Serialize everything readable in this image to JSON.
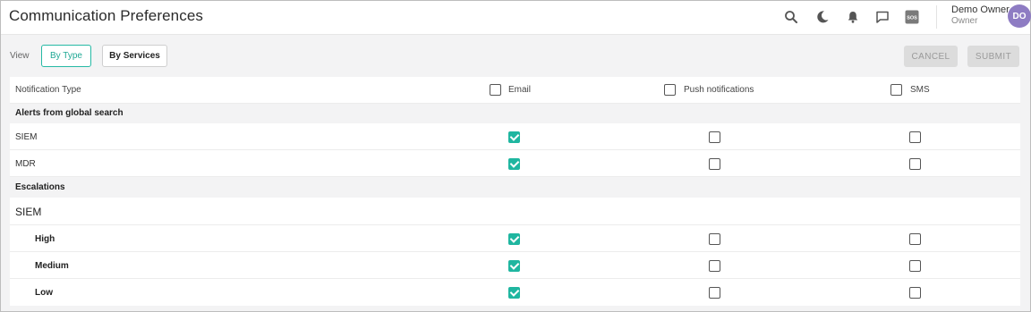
{
  "header": {
    "title": "Communication Preferences",
    "icons": [
      "search-icon",
      "moon-icon",
      "bell-icon",
      "chat-icon",
      "sos-icon"
    ],
    "sos_text": "SOS",
    "user": {
      "name": "Demo Owner",
      "role": "Owner",
      "initials": "DO"
    }
  },
  "toolbar": {
    "view_label": "View",
    "by_type_label": "By Type",
    "by_services_label": "By Services",
    "cancel_label": "CANCEL",
    "submit_label": "SUBMIT"
  },
  "table": {
    "header": {
      "type_label": "Notification Type",
      "email_label": "Email",
      "push_label": "Push notifications",
      "sms_label": "SMS"
    },
    "groups": [
      {
        "title": "Alerts from global search",
        "rows": [
          {
            "label": "SIEM",
            "email": true,
            "push": false,
            "sms": false
          },
          {
            "label": "MDR",
            "email": true,
            "push": false,
            "sms": false
          }
        ]
      },
      {
        "title": "Escalations",
        "subheading": "SIEM",
        "rows": [
          {
            "label": "High",
            "email": true,
            "push": false,
            "sms": false
          },
          {
            "label": "Medium",
            "email": true,
            "push": false,
            "sms": false
          },
          {
            "label": "Low",
            "email": true,
            "push": false,
            "sms": false
          }
        ]
      }
    ]
  },
  "colors": {
    "accent": "#1fb6a0",
    "avatar": "#8e7cc3",
    "disabled_button": "#dcdcdc"
  }
}
